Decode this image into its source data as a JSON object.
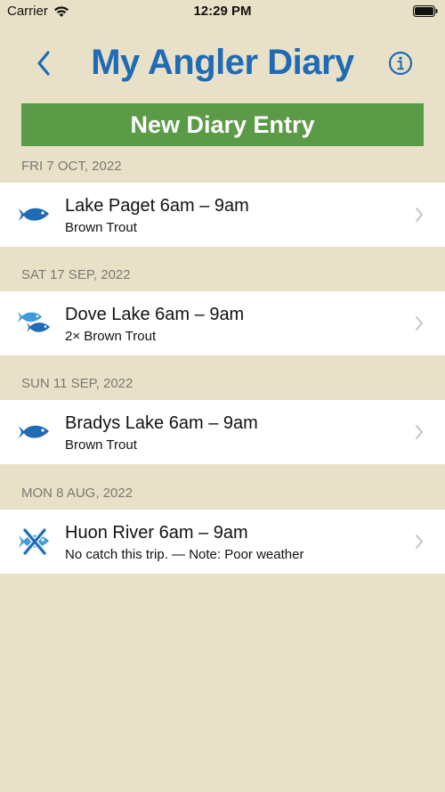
{
  "status_bar": {
    "carrier": "Carrier",
    "time": "12:29 PM"
  },
  "nav": {
    "title": "My Angler Diary",
    "back_icon": "chevron-left-icon",
    "info_icon": "info-circle-icon"
  },
  "new_entry_button": {
    "label": "New Diary Entry"
  },
  "colors": {
    "background": "#e9e1c7",
    "title": "#1f6bb5",
    "button": "#5b9a47",
    "icon_blue": "#1f6bb5",
    "icon_light_blue": "#3f9ad8",
    "section_text": "#7a7a72"
  },
  "entries": [
    {
      "date": "FRI 7 OCT, 2022",
      "title": "Lake Paget 6am – 9am",
      "subtitle": "Brown Trout",
      "icon": "fish-icon"
    },
    {
      "date": "SAT 17 SEP, 2022",
      "title": "Dove Lake 6am – 9am",
      "subtitle": "2× Brown Trout",
      "icon": "two-fish-icon"
    },
    {
      "date": "SUN 11 SEP, 2022",
      "title": "Bradys Lake 6am – 9am",
      "subtitle": "Brown Trout",
      "icon": "fish-icon"
    },
    {
      "date": "MON 8 AUG, 2022",
      "title": "Huon River 6am – 9am",
      "subtitle": "No catch this trip. — Note: Poor weather",
      "icon": "no-catch-fish-icon"
    }
  ]
}
